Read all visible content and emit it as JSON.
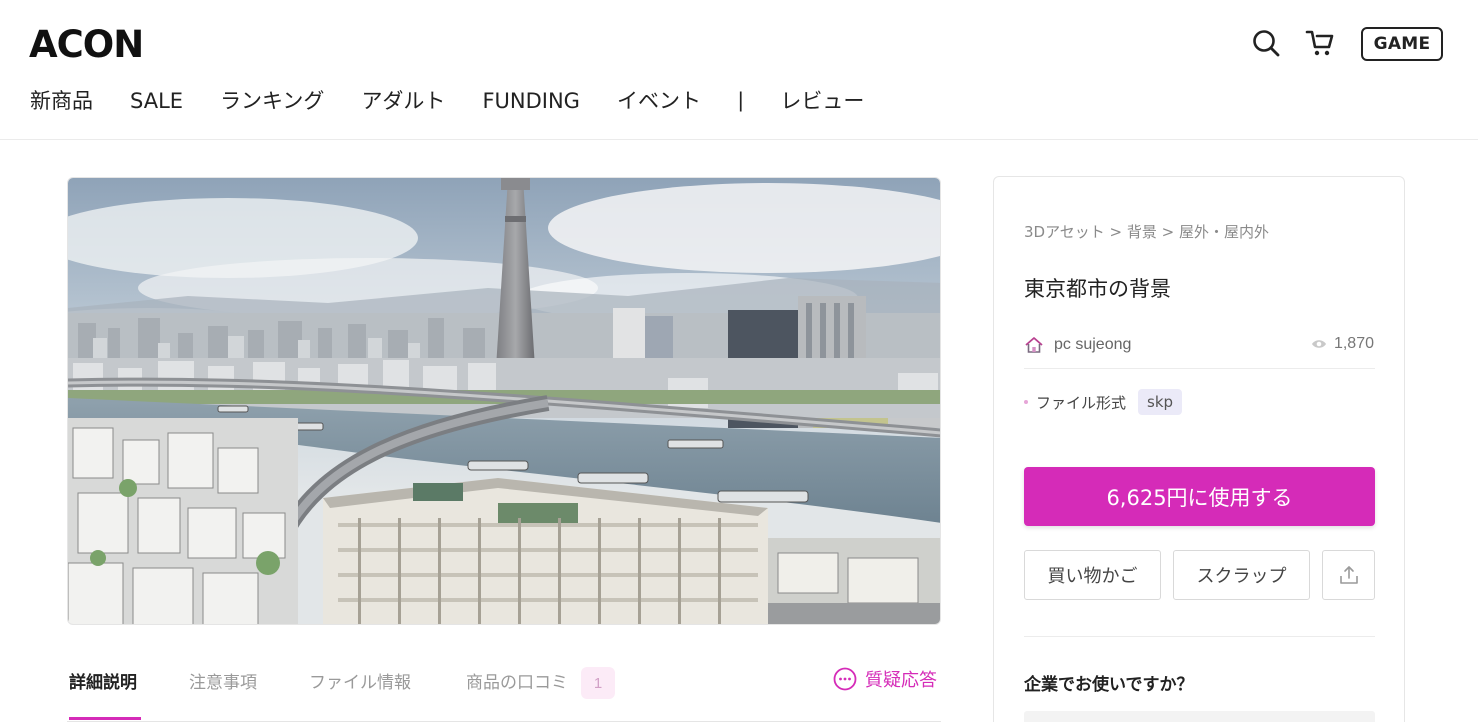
{
  "header": {
    "logo": "ACON",
    "nav": [
      {
        "label": "新商品"
      },
      {
        "label": "SALE"
      },
      {
        "label": "ランキング"
      },
      {
        "label": "アダルト"
      },
      {
        "label": "FUNDING"
      },
      {
        "label": "イベント"
      },
      {
        "label": "|"
      },
      {
        "label": "レビュー"
      }
    ],
    "game_label": "GAME",
    "icons": [
      "search-icon",
      "cart-icon"
    ]
  },
  "product": {
    "breadcrumb": "3Dアセット > 背景 > 屋外・屋内外",
    "title": "東京都市の背景",
    "seller": "pc sujeong",
    "views": "1,870",
    "file_format_label": "ファイル形式",
    "file_format": "skp",
    "buy_label": "6,625円に使用する",
    "cart_label": "買い物かご",
    "scrap_label": "スクラップ",
    "business_label": "企業でお使いですか？"
  },
  "tabs": {
    "items": [
      {
        "label": "詳細説明"
      },
      {
        "label": "注意事項"
      },
      {
        "label": "ファイル情報"
      },
      {
        "label": "商品の口コミ"
      }
    ],
    "review_count": "1",
    "qa_label": "質疑応答"
  },
  "colors": {
    "accent": "#d52bb8",
    "text": "#222222",
    "muted": "#9a9a9a"
  }
}
